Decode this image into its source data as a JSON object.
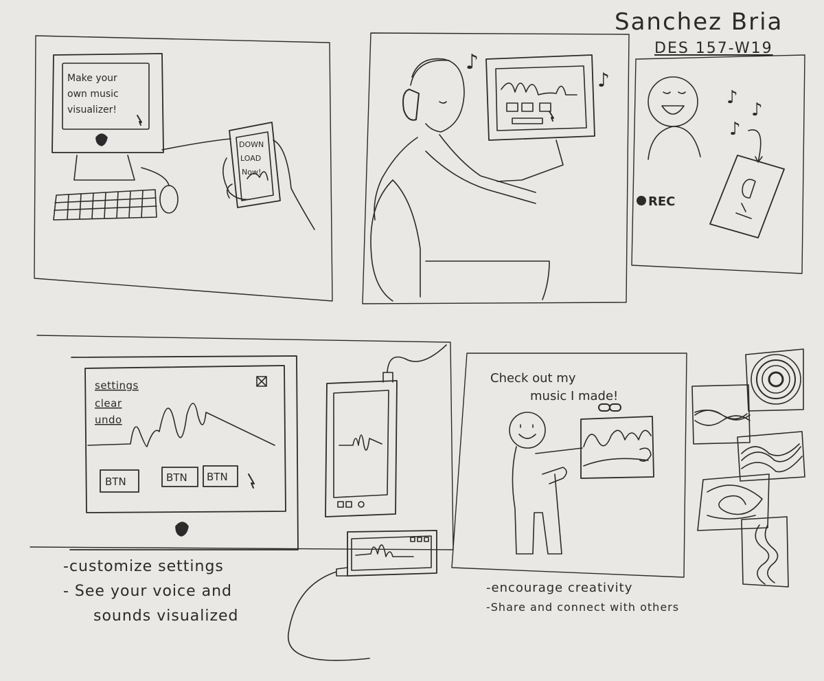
{
  "header": {
    "author": "Sanchez Bria",
    "course": "DES 157-W19"
  },
  "panel1": {
    "screen_lines": [
      "Make your",
      "own music",
      "visualizer!"
    ],
    "phone_lines": [
      "DOWN",
      "LOAD",
      "Now!"
    ]
  },
  "panel3": {
    "rec_label": "REC"
  },
  "panel4": {
    "menu_items": [
      "settings",
      "clear",
      "undo"
    ],
    "buttons": [
      "BTN",
      "BTN",
      "BTN"
    ],
    "notes": [
      "-customize settings",
      "- See your voice and",
      "sounds visualized"
    ]
  },
  "panel5": {
    "speech_lines": [
      "Check out my",
      "music I made!"
    ],
    "notes": [
      "-encourage creativity",
      "-Share and connect with others"
    ]
  },
  "music_note_glyph": "♪",
  "ink_color": "#2b2b2b",
  "paper_color": "#e9e8e4"
}
